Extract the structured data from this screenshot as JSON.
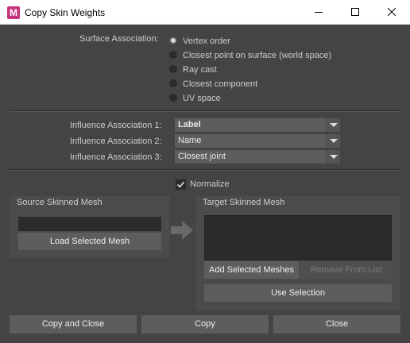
{
  "window": {
    "logo_letter": "M",
    "title": "Copy Skin Weights",
    "controls": [
      "minimize-icon",
      "maximize-icon",
      "close-icon"
    ]
  },
  "surface": {
    "label": "Surface Association:",
    "options": [
      "Vertex order",
      "Closest point on surface (world space)",
      "Ray cast",
      "Closest component",
      "UV space"
    ],
    "selected": "Vertex order"
  },
  "influence": {
    "rows": [
      {
        "label": "Influence Association 1:",
        "value": "Label"
      },
      {
        "label": "Influence Association 2:",
        "value": "Name"
      },
      {
        "label": "Influence Association 3:",
        "value": "Closest joint"
      }
    ]
  },
  "normalize": {
    "label": "Normalize",
    "checked": true
  },
  "source": {
    "title": "Source Skinned Mesh",
    "field_value": "",
    "load_button": "Load Selected Mesh"
  },
  "target": {
    "title": "Target Skinned Mesh",
    "add_button": "Add Selected Meshes",
    "remove_button": "Remove From List",
    "use_selection_button": "Use Selection"
  },
  "footer": {
    "copy_close": "Copy and Close",
    "copy": "Copy",
    "close": "Close"
  },
  "colors": {
    "background": "#444444",
    "button": "#5d5d5d",
    "field": "#2b2b2b",
    "logo": "#c8327a"
  }
}
